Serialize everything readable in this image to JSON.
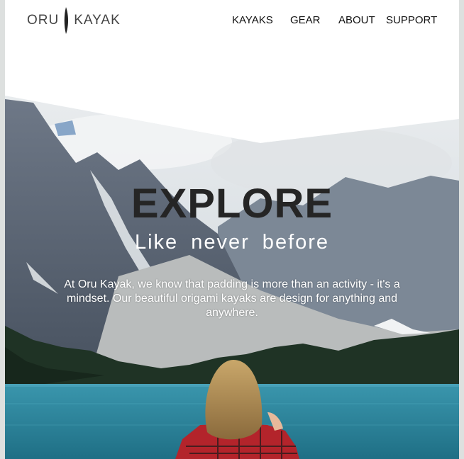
{
  "header": {
    "logo_left": "ORU",
    "logo_right": "KAYAK",
    "nav": [
      {
        "label": "KAYAKS"
      },
      {
        "label": "GEAR"
      },
      {
        "label": "ABOUT"
      },
      {
        "label": "SUPPORT"
      }
    ]
  },
  "hero": {
    "title": "EXPLORE",
    "subtitle": "Like never before",
    "body": "At Oru Kayak, we know that padding is more than an activity - it's a mindset. Our beautiful origami kayaks are design for anything and anywhere."
  },
  "colors": {
    "page_background": "#dde0df",
    "title_color": "#252525",
    "lake": "#2e8aa0"
  }
}
